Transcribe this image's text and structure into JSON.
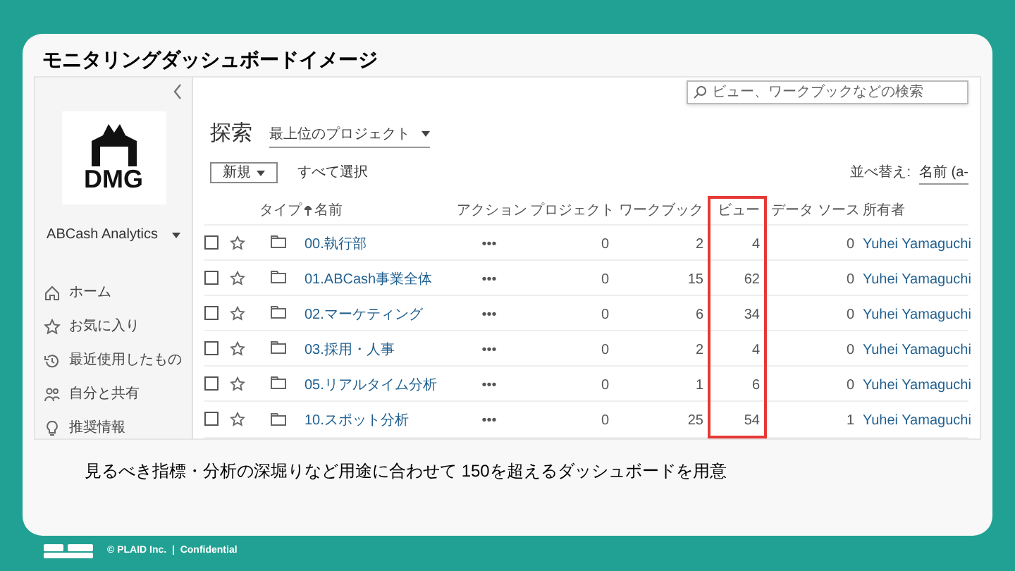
{
  "slide": {
    "title": "モニタリングダッシュボードイメージ",
    "caption": "見るべき指標・分析の深堀りなど用途に合わせて 150を超えるダッシュボードを用意",
    "footer": "© PLAID Inc.  |  Confidential"
  },
  "sidebar": {
    "logo_text": "DMG",
    "site": "ABCash Analytics",
    "nav": [
      {
        "label": "ホーム",
        "kind": "home"
      },
      {
        "label": "お気に入り",
        "kind": "star"
      },
      {
        "label": "最近使用したもの",
        "kind": "recent"
      },
      {
        "label": "自分と共有",
        "kind": "shared"
      },
      {
        "label": "推奨情報",
        "kind": "bulb"
      }
    ]
  },
  "search": {
    "placeholder": "ビュー、ワークブックなどの検索"
  },
  "page": {
    "title": "探索",
    "project_filter": "最上位のプロジェクト",
    "new_button": "新規",
    "select_all": "すべて選択",
    "sort_label": "並べ替え:",
    "sort_value": "名前 (a-"
  },
  "table": {
    "columns": [
      {
        "label": "タイプ",
        "sorted": false,
        "highlighted": false
      },
      {
        "label": "名前",
        "sorted": true,
        "highlighted": false
      },
      {
        "label": "アクション",
        "sorted": false,
        "highlighted": false
      },
      {
        "label": "プロジェクト",
        "sorted": false,
        "highlighted": false
      },
      {
        "label": "ワークブック",
        "sorted": false,
        "highlighted": false
      },
      {
        "label": "ビュー",
        "sorted": false,
        "highlighted": true
      },
      {
        "label": "データ ソース",
        "sorted": false,
        "highlighted": false
      },
      {
        "label": "所有者",
        "sorted": false,
        "highlighted": false
      }
    ],
    "rows": [
      {
        "checked": false,
        "favorite": false,
        "name": "00.執行部",
        "actions": "•••",
        "projects": "0",
        "workbooks": "2",
        "views": "4",
        "data_sources": "0",
        "owner": "Yuhei Yamaguchi"
      },
      {
        "checked": false,
        "favorite": false,
        "name": "01.ABCash事業全体",
        "actions": "•••",
        "projects": "0",
        "workbooks": "15",
        "views": "62",
        "data_sources": "0",
        "owner": "Yuhei Yamaguchi"
      },
      {
        "checked": false,
        "favorite": false,
        "name": "02.マーケティング",
        "actions": "•••",
        "projects": "0",
        "workbooks": "6",
        "views": "34",
        "data_sources": "0",
        "owner": "Yuhei Yamaguchi"
      },
      {
        "checked": false,
        "favorite": false,
        "name": "03.採用・人事",
        "actions": "•••",
        "projects": "0",
        "workbooks": "2",
        "views": "4",
        "data_sources": "0",
        "owner": "Yuhei Yamaguchi"
      },
      {
        "checked": false,
        "favorite": false,
        "name": "05.リアルタイム分析",
        "actions": "•••",
        "projects": "0",
        "workbooks": "1",
        "views": "6",
        "data_sources": "0",
        "owner": "Yuhei Yamaguchi"
      },
      {
        "checked": false,
        "favorite": false,
        "name": "10.スポット分析",
        "actions": "•••",
        "projects": "0",
        "workbooks": "25",
        "views": "54",
        "data_sources": "1",
        "owner": "Yuhei Yamaguchi"
      }
    ]
  }
}
